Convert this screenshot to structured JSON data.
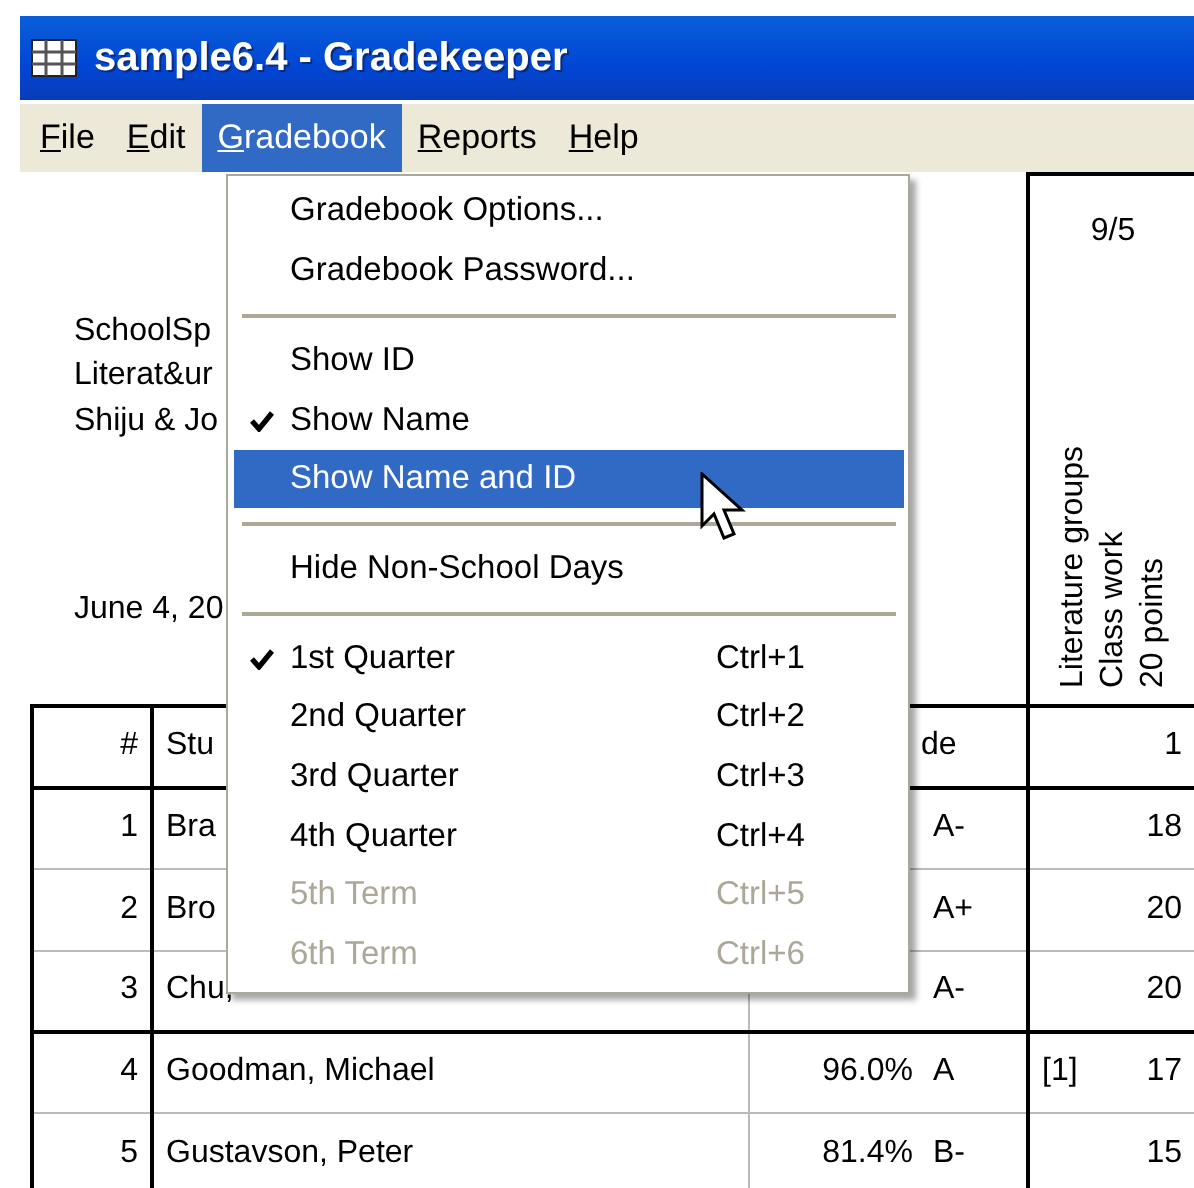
{
  "window": {
    "title": "sample6.4 - Gradekeeper"
  },
  "menu_bar": [
    {
      "label": "File",
      "selected": false
    },
    {
      "label": "Edit",
      "selected": false
    },
    {
      "label": "Gradebook",
      "selected": true
    },
    {
      "label": "Reports",
      "selected": false
    },
    {
      "label": "Help",
      "selected": false
    }
  ],
  "report_header": {
    "lines": [
      "SchoolSp",
      "Literat&ur",
      "Shiju & Jo"
    ],
    "date": "June 4, 20"
  },
  "assignment": {
    "date": "9/5",
    "heading_lines": [
      "Literature groups",
      "Class work",
      "20 points"
    ]
  },
  "table": {
    "columns": [
      "#",
      "Stu",
      "de",
      "1"
    ],
    "rows": [
      {
        "number": "1",
        "student": "Bra",
        "grade": "A-",
        "score": "18"
      },
      {
        "number": "2",
        "student": "Bro",
        "grade": "A+",
        "score": "20"
      },
      {
        "number": "3",
        "student": "Chu,",
        "grade": "A-",
        "score": "20"
      },
      {
        "number": "4",
        "student": "Goodman, Michael",
        "percent": "96.0%",
        "grade": "A",
        "note": "[1]",
        "score": "17"
      },
      {
        "number": "5",
        "student": "Gustavson, Peter",
        "percent": "81.4%",
        "grade": "B-",
        "score": "15"
      }
    ]
  },
  "dropdown": {
    "items": [
      {
        "kind": "item",
        "label": "Gradebook Options...",
        "checked": false,
        "selected": false,
        "disabled": false
      },
      {
        "kind": "item",
        "label": "Gradebook Password...",
        "checked": false,
        "selected": false,
        "disabled": false
      },
      {
        "kind": "separator"
      },
      {
        "kind": "item",
        "label": "Show ID",
        "checked": false,
        "selected": false,
        "disabled": false
      },
      {
        "kind": "item",
        "label": "Show Name",
        "checked": true,
        "selected": false,
        "disabled": false
      },
      {
        "kind": "item",
        "label": "Show Name and ID",
        "checked": false,
        "selected": true,
        "disabled": false
      },
      {
        "kind": "separator"
      },
      {
        "kind": "item",
        "label": "Hide Non-School Days",
        "checked": false,
        "selected": false,
        "disabled": false
      },
      {
        "kind": "separator"
      },
      {
        "kind": "item",
        "label": "1st Quarter",
        "shortcut": "Ctrl+1",
        "checked": true,
        "selected": false,
        "disabled": false
      },
      {
        "kind": "item",
        "label": "2nd Quarter",
        "shortcut": "Ctrl+2",
        "checked": false,
        "selected": false,
        "disabled": false
      },
      {
        "kind": "item",
        "label": "3rd Quarter",
        "shortcut": "Ctrl+3",
        "checked": false,
        "selected": false,
        "disabled": false
      },
      {
        "kind": "item",
        "label": "4th Quarter",
        "shortcut": "Ctrl+4",
        "checked": false,
        "selected": false,
        "disabled": false
      },
      {
        "kind": "item",
        "label": "5th Term",
        "shortcut": "Ctrl+5",
        "checked": false,
        "selected": false,
        "disabled": true
      },
      {
        "kind": "item",
        "label": "6th Term",
        "shortcut": "Ctrl+6",
        "checked": false,
        "selected": false,
        "disabled": true
      }
    ]
  }
}
